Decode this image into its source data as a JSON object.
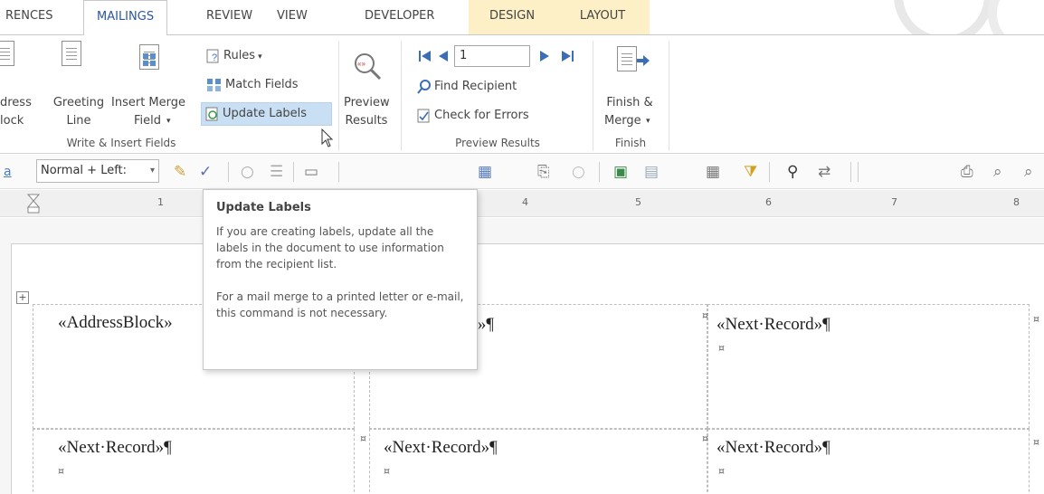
{
  "tabs": {
    "items": [
      "RENCES",
      "MAILINGS",
      "REVIEW",
      "VIEW",
      "DEVELOPER",
      "DESIGN",
      "LAYOUT"
    ],
    "active": "MAILINGS",
    "active_color": "#2b579a",
    "contextual_color": "#fdf0c6"
  },
  "ribbon": {
    "write_insert": {
      "address_block": [
        "dress",
        "lock"
      ],
      "greeting_line": [
        "Greeting",
        "Line"
      ],
      "insert_merge_field": [
        "Insert Merge",
        "Field"
      ],
      "rules": "Rules",
      "match_fields": "Match Fields",
      "update_labels": "Update Labels",
      "group_label": "Write & Insert Fields"
    },
    "preview": {
      "preview_results": [
        "Preview",
        "Results"
      ],
      "record_number": "1",
      "find_recipient": "Find Recipient",
      "check_for_errors": "Check for Errors",
      "group_label": "Preview Results"
    },
    "finish": {
      "finish_merge": [
        "Finish &",
        "Merge"
      ],
      "group_label": "Finish"
    },
    "highlight_color": "#c9e0f4"
  },
  "toolbar": {
    "style": "Normal + Left:"
  },
  "ruler": {
    "numbers": [
      "1",
      "4",
      "5",
      "6",
      "7",
      "8"
    ]
  },
  "tooltip": {
    "title": "Update Labels",
    "body1": "If you are creating labels, update all the labels in the document to use information from the recipient list.",
    "body2": "For a mail merge to a printed letter or e-mail, this command is not necessary."
  },
  "document": {
    "cells": [
      [
        "«AddressBlock»",
        "rd»¶",
        "«Next·Record»¶"
      ],
      [
        "«Next·Record»¶",
        "«Next·Record»¶",
        "«Next·Record»¶"
      ]
    ],
    "end_mark": "¤"
  }
}
